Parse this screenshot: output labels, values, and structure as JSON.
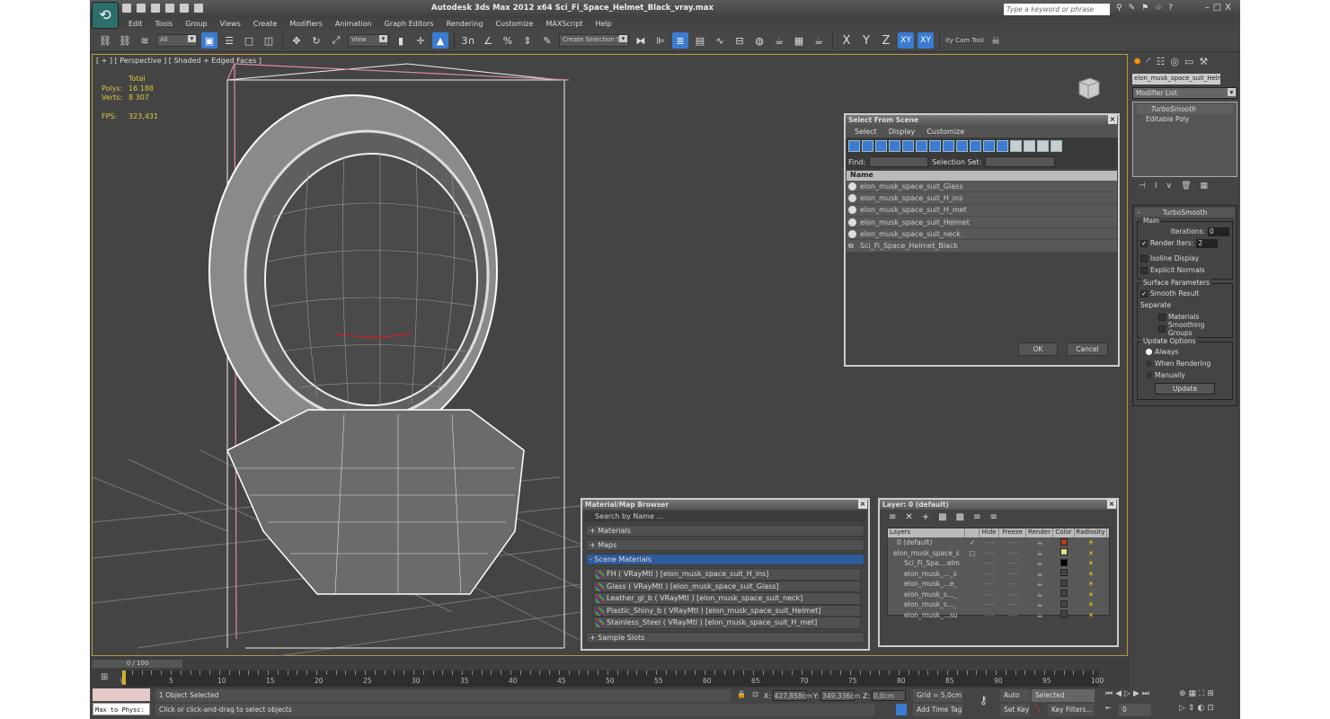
{
  "app": {
    "title": "Autodesk 3ds Max  2012 x64     Sci_Fi_Space_Helmet_Black_vray.max",
    "search_placeholder": "Type a keyword or phrase"
  },
  "menu": [
    "Edit",
    "Tools",
    "Group",
    "Views",
    "Create",
    "Modifiers",
    "Animation",
    "Graph Editors",
    "Rendering",
    "Customize",
    "MAXScript",
    "Help"
  ],
  "toolbar": {
    "filter": "All",
    "ref_coord": "View",
    "selection_set": "Create Selection Se",
    "axes": [
      "X",
      "Y",
      "Z",
      "XY",
      "XY"
    ],
    "cam_tool": "ity Cam Tool"
  },
  "viewport": {
    "label": "[ + ] [ Perspective ] [ Shaded + Edged Faces ]",
    "stats": {
      "total": "Total",
      "polys_label": "Polys:",
      "polys": "16 188",
      "verts_label": "Verts:",
      "verts": "8 307",
      "fps_label": "FPS:",
      "fps": "323,431"
    }
  },
  "select_dialog": {
    "title": "Select From Scene",
    "menu": [
      "Select",
      "Display",
      "Customize"
    ],
    "find_label": "Find:",
    "selset_label": "Selection Set:",
    "column": "Name",
    "items": [
      "elon_musk_space_suit_Glass",
      "elon_musk_space_suit_H_ins",
      "elon_musk_space_suit_H_met",
      "elon_musk_space_suit_Helmet",
      "elon_musk_space_suit_neck",
      "Sci_Fi_Space_Helmet_Black"
    ],
    "ok": "OK",
    "cancel": "Cancel"
  },
  "material_browser": {
    "title": "Material/Map Browser",
    "search_placeholder": "Search by Name ...",
    "groups": {
      "materials": "+ Materials",
      "maps": "+ Maps",
      "scene": "- Scene Materials",
      "slots": "+ Sample Slots"
    },
    "scene_materials": [
      "FH  ( VRayMtl ) [elon_musk_space_suit_H_ins]",
      "Glass  ( VRayMtl ) [elon_musk_space_suit_Glass]",
      "Leather_gl_b  ( VRayMtl ) [elon_musk_space_suit_neck]",
      "Plastic_Shiny_b  ( VRayMtl ) [elon_musk_space_suit_Helmet]",
      "Stainless_Steel  ( VRayMtl ) [elon_musk_space_suit_H_met]"
    ]
  },
  "layer_dialog": {
    "title": "Layer: 0 (default)",
    "columns": [
      "Layers",
      "Hide",
      "Freeze",
      "Render",
      "Color",
      "Radiosity"
    ],
    "rows": [
      {
        "name": "0 (default)",
        "color": "#b4401a"
      },
      {
        "name": "elon_musk_space_s",
        "color": "#d8e48a"
      },
      {
        "name": "Sci_Fi_Spa....elm",
        "color": "#000000"
      },
      {
        "name": "elon_musk_..._s",
        "color": "#444444"
      },
      {
        "name": "elon_musk_...e_",
        "color": "#444444"
      },
      {
        "name": "elon_musk_s..._",
        "color": "#444444"
      },
      {
        "name": "elon_musk_s..._",
        "color": "#444444"
      },
      {
        "name": "elon_musk_...su",
        "color": "#444444"
      }
    ],
    "dash": "----"
  },
  "command_panel": {
    "object_name": "elon_musk_space_suit_Helme",
    "modifier_list": "Modifier List",
    "stack": [
      "TurboSmooth",
      "Editable Poly"
    ],
    "rollout": "TurboSmooth",
    "main": "Main",
    "iterations_label": "Iterations:",
    "iterations": "0",
    "render_iters_label": "Render Iters:",
    "render_iters": "2",
    "isoline": "Isoline Display",
    "explicit": "Explicit Normals",
    "surface": "Surface Parameters",
    "smooth_result": "Smooth Result",
    "separate": "Separate",
    "materials": "Materials",
    "smoothing_groups": "Smoothing Groups",
    "update_options": "Update Options",
    "always": "Always",
    "when_rendering": "When Rendering",
    "manually": "Manually",
    "update": "Update"
  },
  "timeline": {
    "frame": "0 / 100",
    "ticks": [
      "0",
      "5",
      "10",
      "15",
      "20",
      "25",
      "30",
      "35",
      "40",
      "45",
      "50",
      "55",
      "60",
      "65",
      "70",
      "75",
      "80",
      "85",
      "90",
      "95",
      "100"
    ]
  },
  "status": {
    "selected": "1 Object Selected",
    "prompt": "Click or click-and-drag to select objects",
    "maxscript": "Max to Physc:",
    "x": "427,858cm",
    "y": "349,336cm",
    "z": "0,0cm",
    "grid": "Grid = 5,0cm",
    "add_time_tag": "Add Time Tag",
    "auto_key": "Auto Key",
    "set_key": "Set Key",
    "key_mode": "Selected",
    "key_filters": "Key Filters...",
    "frame": "0"
  }
}
